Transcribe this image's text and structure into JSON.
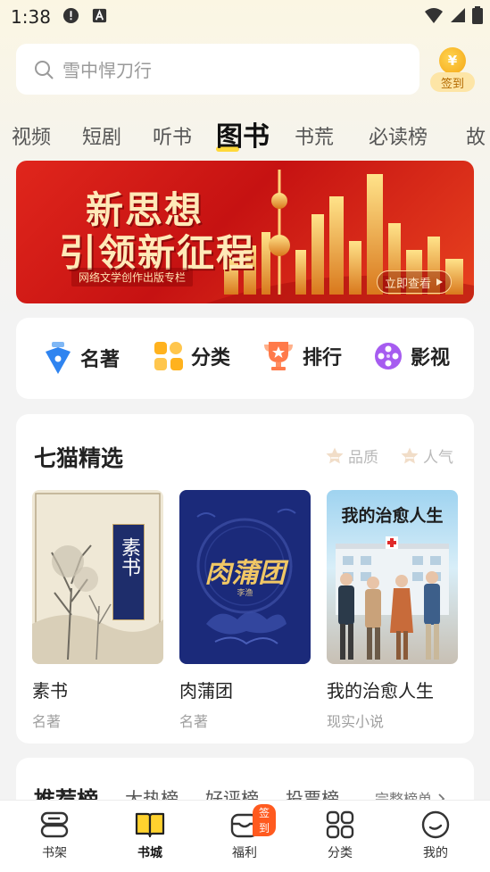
{
  "status_bar": {
    "time": "1:38"
  },
  "search": {
    "placeholder": "雪中悍刀行",
    "checkin_coin": "¥",
    "checkin_label": "签到"
  },
  "tabs": [
    "视频",
    "短剧",
    "听书",
    "图书",
    "书荒",
    "必读榜",
    "故"
  ],
  "active_tab": "图书",
  "banner": {
    "line1": "新思想",
    "line2": "引领新征程",
    "subtitle": "网络文学创作出版专栏",
    "button": "立即查看"
  },
  "shortcuts": [
    {
      "label": "名著",
      "icon": "pen-nib-icon"
    },
    {
      "label": "分类",
      "icon": "grid-icon"
    },
    {
      "label": "排行",
      "icon": "trophy-icon"
    },
    {
      "label": "影视",
      "icon": "film-reel-icon"
    }
  ],
  "featured": {
    "title": "七猫精选",
    "filters": [
      "品质",
      "人气"
    ],
    "books": [
      {
        "name": "素书",
        "category": "名著",
        "cover_text": "素书"
      },
      {
        "name": "肉蒲团",
        "category": "名著",
        "cover_text": "肉蒲团",
        "cover_author": "李渔"
      },
      {
        "name": "我的治愈人生",
        "category": "现实小说",
        "cover_text": "我的治愈人生"
      }
    ]
  },
  "ranking": {
    "title": "推荐榜",
    "tabs": [
      "大热榜",
      "好评榜",
      "投票榜"
    ],
    "more": "完整榜单"
  },
  "bottom_nav": [
    {
      "label": "书架",
      "icon": "bookshelf-icon"
    },
    {
      "label": "书城",
      "icon": "open-book-icon"
    },
    {
      "label": "福利",
      "icon": "inbox-icon",
      "badge": "签到"
    },
    {
      "label": "分类",
      "icon": "category-grid-icon"
    },
    {
      "label": "我的",
      "icon": "smiley-icon"
    }
  ],
  "colors": {
    "accent_yellow": "#ffd93a",
    "banner_red": "#d41a14",
    "badge_orange": "#ff5a1f"
  }
}
